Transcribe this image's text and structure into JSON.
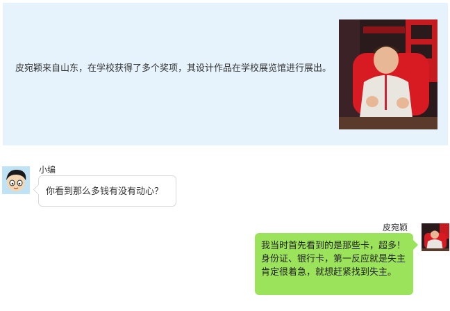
{
  "intro": {
    "text": "皮宛颖来自山东，在学校获得了多个奖项，其设计作品在学校展览馆进行展出。"
  },
  "messages": [
    {
      "sender": "小编",
      "text": "你看到那么多钱有没有动心？"
    },
    {
      "sender": "皮宛颖",
      "text": "我当时首先看到的是那些卡，超多！身份证、银行卡，第一反应就是失主肯定很着急，就想赶紧找到失主。"
    }
  ],
  "colors": {
    "intro_bg": "#e6f3fc",
    "right_bubble": "#9be35a",
    "left_bubble_border": "#d9d9d9"
  }
}
